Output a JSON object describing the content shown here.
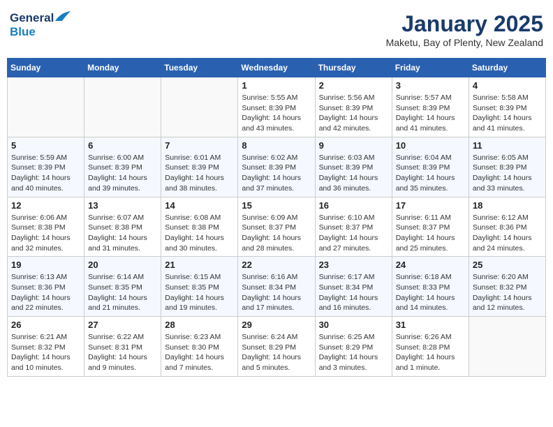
{
  "header": {
    "logo_general": "General",
    "logo_blue": "Blue",
    "month_title": "January 2025",
    "location": "Maketu, Bay of Plenty, New Zealand"
  },
  "weekdays": [
    "Sunday",
    "Monday",
    "Tuesday",
    "Wednesday",
    "Thursday",
    "Friday",
    "Saturday"
  ],
  "weeks": [
    [
      {
        "day": "",
        "info": ""
      },
      {
        "day": "",
        "info": ""
      },
      {
        "day": "",
        "info": ""
      },
      {
        "day": "1",
        "info": "Sunrise: 5:55 AM\nSunset: 8:39 PM\nDaylight: 14 hours\nand 43 minutes."
      },
      {
        "day": "2",
        "info": "Sunrise: 5:56 AM\nSunset: 8:39 PM\nDaylight: 14 hours\nand 42 minutes."
      },
      {
        "day": "3",
        "info": "Sunrise: 5:57 AM\nSunset: 8:39 PM\nDaylight: 14 hours\nand 41 minutes."
      },
      {
        "day": "4",
        "info": "Sunrise: 5:58 AM\nSunset: 8:39 PM\nDaylight: 14 hours\nand 41 minutes."
      }
    ],
    [
      {
        "day": "5",
        "info": "Sunrise: 5:59 AM\nSunset: 8:39 PM\nDaylight: 14 hours\nand 40 minutes."
      },
      {
        "day": "6",
        "info": "Sunrise: 6:00 AM\nSunset: 8:39 PM\nDaylight: 14 hours\nand 39 minutes."
      },
      {
        "day": "7",
        "info": "Sunrise: 6:01 AM\nSunset: 8:39 PM\nDaylight: 14 hours\nand 38 minutes."
      },
      {
        "day": "8",
        "info": "Sunrise: 6:02 AM\nSunset: 8:39 PM\nDaylight: 14 hours\nand 37 minutes."
      },
      {
        "day": "9",
        "info": "Sunrise: 6:03 AM\nSunset: 8:39 PM\nDaylight: 14 hours\nand 36 minutes."
      },
      {
        "day": "10",
        "info": "Sunrise: 6:04 AM\nSunset: 8:39 PM\nDaylight: 14 hours\nand 35 minutes."
      },
      {
        "day": "11",
        "info": "Sunrise: 6:05 AM\nSunset: 8:39 PM\nDaylight: 14 hours\nand 33 minutes."
      }
    ],
    [
      {
        "day": "12",
        "info": "Sunrise: 6:06 AM\nSunset: 8:38 PM\nDaylight: 14 hours\nand 32 minutes."
      },
      {
        "day": "13",
        "info": "Sunrise: 6:07 AM\nSunset: 8:38 PM\nDaylight: 14 hours\nand 31 minutes."
      },
      {
        "day": "14",
        "info": "Sunrise: 6:08 AM\nSunset: 8:38 PM\nDaylight: 14 hours\nand 30 minutes."
      },
      {
        "day": "15",
        "info": "Sunrise: 6:09 AM\nSunset: 8:37 PM\nDaylight: 14 hours\nand 28 minutes."
      },
      {
        "day": "16",
        "info": "Sunrise: 6:10 AM\nSunset: 8:37 PM\nDaylight: 14 hours\nand 27 minutes."
      },
      {
        "day": "17",
        "info": "Sunrise: 6:11 AM\nSunset: 8:37 PM\nDaylight: 14 hours\nand 25 minutes."
      },
      {
        "day": "18",
        "info": "Sunrise: 6:12 AM\nSunset: 8:36 PM\nDaylight: 14 hours\nand 24 minutes."
      }
    ],
    [
      {
        "day": "19",
        "info": "Sunrise: 6:13 AM\nSunset: 8:36 PM\nDaylight: 14 hours\nand 22 minutes."
      },
      {
        "day": "20",
        "info": "Sunrise: 6:14 AM\nSunset: 8:35 PM\nDaylight: 14 hours\nand 21 minutes."
      },
      {
        "day": "21",
        "info": "Sunrise: 6:15 AM\nSunset: 8:35 PM\nDaylight: 14 hours\nand 19 minutes."
      },
      {
        "day": "22",
        "info": "Sunrise: 6:16 AM\nSunset: 8:34 PM\nDaylight: 14 hours\nand 17 minutes."
      },
      {
        "day": "23",
        "info": "Sunrise: 6:17 AM\nSunset: 8:34 PM\nDaylight: 14 hours\nand 16 minutes."
      },
      {
        "day": "24",
        "info": "Sunrise: 6:18 AM\nSunset: 8:33 PM\nDaylight: 14 hours\nand 14 minutes."
      },
      {
        "day": "25",
        "info": "Sunrise: 6:20 AM\nSunset: 8:32 PM\nDaylight: 14 hours\nand 12 minutes."
      }
    ],
    [
      {
        "day": "26",
        "info": "Sunrise: 6:21 AM\nSunset: 8:32 PM\nDaylight: 14 hours\nand 10 minutes."
      },
      {
        "day": "27",
        "info": "Sunrise: 6:22 AM\nSunset: 8:31 PM\nDaylight: 14 hours\nand 9 minutes."
      },
      {
        "day": "28",
        "info": "Sunrise: 6:23 AM\nSunset: 8:30 PM\nDaylight: 14 hours\nand 7 minutes."
      },
      {
        "day": "29",
        "info": "Sunrise: 6:24 AM\nSunset: 8:29 PM\nDaylight: 14 hours\nand 5 minutes."
      },
      {
        "day": "30",
        "info": "Sunrise: 6:25 AM\nSunset: 8:29 PM\nDaylight: 14 hours\nand 3 minutes."
      },
      {
        "day": "31",
        "info": "Sunrise: 6:26 AM\nSunset: 8:28 PM\nDaylight: 14 hours\nand 1 minute."
      },
      {
        "day": "",
        "info": ""
      }
    ]
  ]
}
